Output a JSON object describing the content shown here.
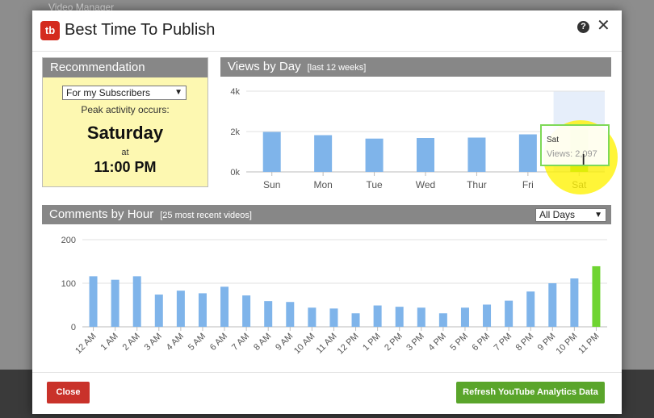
{
  "background": {
    "tab_label": "Video Manager"
  },
  "dialog": {
    "logo_text": "tb",
    "title": "Best Time To Publish",
    "help_label": "?",
    "close_label": "✕"
  },
  "recommendation": {
    "title": "Recommendation",
    "audience_select": "For my Subscribers",
    "peak_label": "Peak activity occurs:",
    "peak_day": "Saturday",
    "at_label": "at",
    "peak_time": "11:00 PM"
  },
  "views_panel": {
    "title": "Views by Day",
    "subtitle": "[last 12 weeks]"
  },
  "comments_panel": {
    "title": "Comments by Hour",
    "subtitle": "[25 most recent videos]",
    "days_select": "All Days"
  },
  "tooltip": {
    "day": "Sat",
    "value": "Views: 2,097"
  },
  "buttons": {
    "close": "Close",
    "refresh": "Refresh YouTube Analytics Data"
  },
  "colors": {
    "bar": "#7fb4ea",
    "highlight_bar": "#6fd431",
    "header": "#878787",
    "recommendation_bg": "#fdf8b1"
  },
  "chart_data": [
    {
      "type": "bar",
      "title": "Views by Day",
      "categories": [
        "Sun",
        "Mon",
        "Tue",
        "Wed",
        "Thur",
        "Fri",
        "Sat"
      ],
      "values": [
        1980,
        1820,
        1650,
        1680,
        1700,
        1860,
        2097
      ],
      "yticks": [
        "0k",
        "2k",
        "4k"
      ],
      "ylim": [
        0,
        4000
      ],
      "highlight_index": 6,
      "grid": true
    },
    {
      "type": "bar",
      "title": "Comments by Hour",
      "categories": [
        "12 AM",
        "1 AM",
        "2 AM",
        "3 AM",
        "4 AM",
        "5 AM",
        "6 AM",
        "7 AM",
        "8 AM",
        "9 AM",
        "10 AM",
        "11 AM",
        "12 PM",
        "1 PM",
        "2 PM",
        "3 PM",
        "4 PM",
        "5 PM",
        "6 PM",
        "7 PM",
        "8 PM",
        "9 PM",
        "10 PM",
        "11 PM"
      ],
      "values": [
        116,
        108,
        116,
        74,
        83,
        77,
        92,
        72,
        59,
        57,
        44,
        42,
        31,
        49,
        46,
        44,
        31,
        44,
        51,
        60,
        81,
        100,
        111,
        139
      ],
      "yticks": [
        "0",
        "100",
        "200"
      ],
      "ylim": [
        0,
        200
      ],
      "highlight_index": 23,
      "grid": true
    }
  ]
}
